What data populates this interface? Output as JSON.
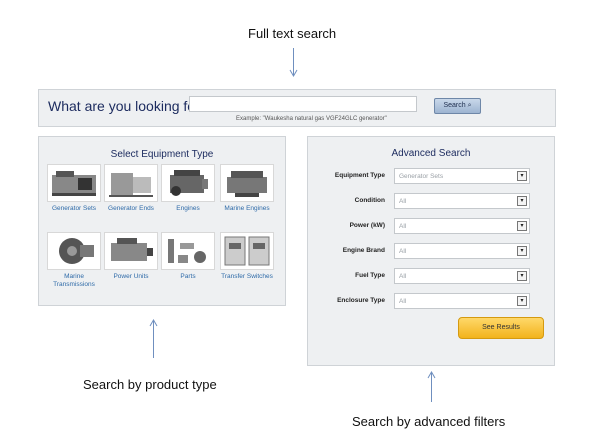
{
  "annotations": {
    "top": "Full text search",
    "bottom_left": "Search by product type",
    "bottom_right": "Search by advanced filters"
  },
  "search": {
    "question": "What are you looking for?",
    "button_label": "Search",
    "example": "Example: \"Waukesha natural gas VGF24GLC generator\""
  },
  "equipment": {
    "title": "Select Equipment Type",
    "items": [
      {
        "label": "Generator Sets"
      },
      {
        "label": "Generator Ends"
      },
      {
        "label": "Engines"
      },
      {
        "label": "Marine Engines"
      },
      {
        "label": "Marine Transmissions"
      },
      {
        "label": "Power Units"
      },
      {
        "label": "Parts"
      },
      {
        "label": "Transfer Switches"
      }
    ]
  },
  "advanced": {
    "title": "Advanced Search",
    "fields": [
      {
        "label": "Equipment Type",
        "value": "Generator Sets"
      },
      {
        "label": "Condition",
        "value": "All"
      },
      {
        "label": "Power (kW)",
        "value": "All"
      },
      {
        "label": "Engine Brand",
        "value": "All"
      },
      {
        "label": "Fuel Type",
        "value": "All"
      },
      {
        "label": "Enclosure Type",
        "value": "All"
      }
    ],
    "results_button": "See Results"
  }
}
